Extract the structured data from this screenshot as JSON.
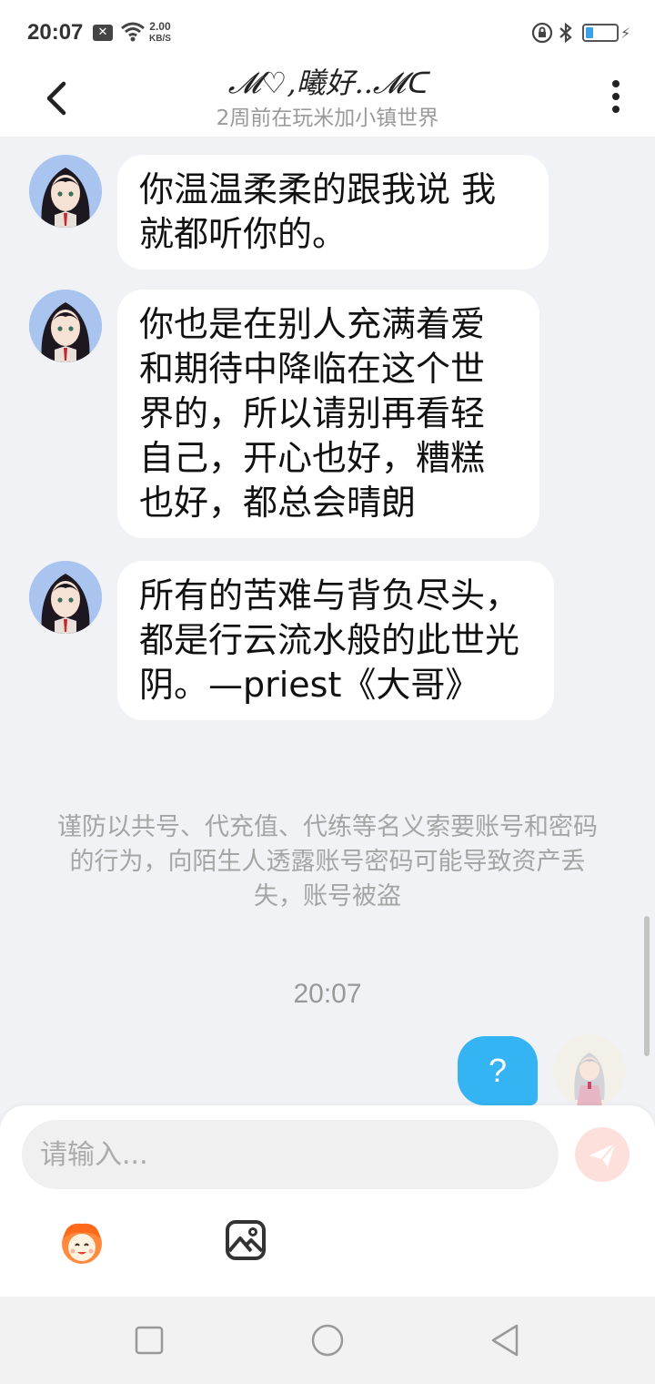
{
  "status": {
    "time": "20:07",
    "speed_value": "2.00",
    "speed_unit": "KB/S"
  },
  "header": {
    "title": "𝓜♡,曦好..𝓜ᑕ",
    "subtitle": "2周前在玩米加小镇世界"
  },
  "messages": [
    {
      "text": "你温温柔柔的跟我说 我就都听你的。"
    },
    {
      "text": "你也是在别人充满着爱和期待中降临在这个世界的，所以请别再看轻自己，开心也好，糟糕也好，都总会晴朗"
    },
    {
      "text": "所有的苦难与背负尽头，都是行云流水般的此世光阴。—priest《大哥》"
    }
  ],
  "notice": "谨防以共号、代充值、代练等名义索要账号和密码的行为，向陌生人透露账号密码可能导致资产丢失，账号被盗",
  "timestamp": "20:07",
  "my_message": "?",
  "input": {
    "placeholder": "请输入..."
  },
  "colors": {
    "my_bubble": "#34b4f2",
    "background": "#f0f2f5",
    "send_button": "#fde0dc"
  }
}
